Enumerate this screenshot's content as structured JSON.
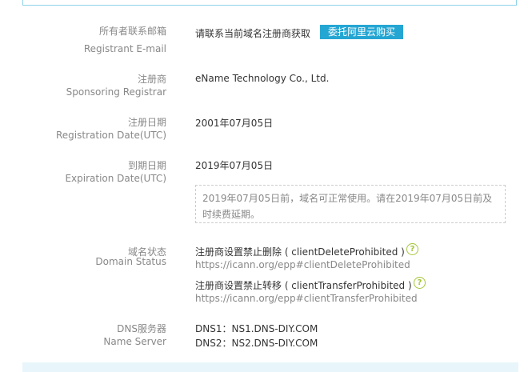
{
  "fields": {
    "email": {
      "cn": "所有者联系邮箱",
      "en": "Registrant E-mail",
      "value": "请联系当前域名注册商获取",
      "button": "委托阿里云购买"
    },
    "registrar": {
      "cn": "注册商",
      "en": "Sponsoring Registrar",
      "value": "eName Technology Co., Ltd."
    },
    "reg_date": {
      "cn": "注册日期",
      "en": "Registration Date(UTC)",
      "value": "2001年07月05日"
    },
    "exp_date": {
      "cn": "到期日期",
      "en": "Expiration Date(UTC)",
      "value": "2019年07月05日",
      "notice": "2019年07月05日前，域名可正常使用。请在2019年07月05日前及时续费延期。"
    },
    "status": {
      "cn": "域名状态",
      "en": "Domain Status",
      "items": [
        {
          "label": "注册商设置禁止删除 ( clientDeleteProhibited )",
          "url": "https://icann.org/epp#clientDeleteProhibited"
        },
        {
          "label": "注册商设置禁止转移 ( clientTransferProhibited )",
          "url": "https://icann.org/epp#clientTransferProhibited"
        }
      ]
    },
    "dns": {
      "cn": "DNS服务器",
      "en": "Name Server",
      "values": [
        "DNS1：NS1.DNS-DIY.COM",
        "DNS2：NS2.DNS-DIY.COM"
      ]
    }
  },
  "colors": {
    "accent": "#24a6d3",
    "help_icon": "#a5c639"
  },
  "icons": {
    "help": "question-circle-icon"
  }
}
